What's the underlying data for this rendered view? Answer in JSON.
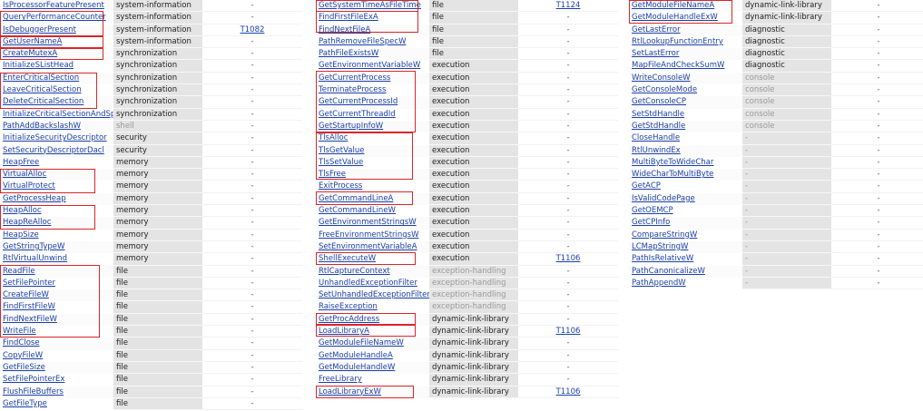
{
  "columns": [
    {
      "rows": [
        {
          "api": "IsProcessorFeaturePresent",
          "category": "system-information",
          "technique": "-"
        },
        {
          "api": "QueryPerformanceCounter",
          "category": "system-information",
          "technique": "-"
        },
        {
          "api": "IsDebuggerPresent",
          "category": "system-information",
          "technique": "T1082"
        },
        {
          "api": "GetUserNameA",
          "category": "system-information",
          "technique": "-"
        },
        {
          "api": "CreateMutexA",
          "category": "synchronization",
          "technique": "-"
        },
        {
          "api": "InitializeSListHead",
          "category": "synchronization",
          "technique": "-"
        },
        {
          "api": "EnterCriticalSection",
          "category": "synchronization",
          "technique": "-"
        },
        {
          "api": "LeaveCriticalSection",
          "category": "synchronization",
          "technique": "-"
        },
        {
          "api": "DeleteCriticalSection",
          "category": "synchronization",
          "technique": "-"
        },
        {
          "api": "InitializeCriticalSectionAndSpi...",
          "category": "synchronization",
          "technique": "-"
        },
        {
          "api": "PathAddBackslashW",
          "category": "shell",
          "technique": "-",
          "dim": true
        },
        {
          "api": "InitializeSecurityDescriptor",
          "category": "security",
          "technique": "-"
        },
        {
          "api": "SetSecurityDescriptorDacl",
          "category": "security",
          "technique": "-"
        },
        {
          "api": "HeapFree",
          "category": "memory",
          "technique": "-"
        },
        {
          "api": "VirtualAlloc",
          "category": "memory",
          "technique": "-"
        },
        {
          "api": "VirtualProtect",
          "category": "memory",
          "technique": "-"
        },
        {
          "api": "GetProcessHeap",
          "category": "memory",
          "technique": "-"
        },
        {
          "api": "HeapAlloc",
          "category": "memory",
          "technique": "-"
        },
        {
          "api": "HeapReAlloc",
          "category": "memory",
          "technique": "-"
        },
        {
          "api": "HeapSize",
          "category": "memory",
          "technique": "-"
        },
        {
          "api": "GetStringTypeW",
          "category": "memory",
          "technique": "-"
        },
        {
          "api": "RtlVirtualUnwind",
          "category": "memory",
          "technique": "-"
        },
        {
          "api": "ReadFile",
          "category": "file",
          "technique": "-"
        },
        {
          "api": "SetFilePointer",
          "category": "file",
          "technique": "-"
        },
        {
          "api": "CreateFileW",
          "category": "file",
          "technique": "-"
        },
        {
          "api": "FindFirstFileW",
          "category": "file",
          "technique": "-"
        },
        {
          "api": "FindNextFileW",
          "category": "file",
          "technique": "-"
        },
        {
          "api": "WriteFile",
          "category": "file",
          "technique": "-"
        },
        {
          "api": "FindClose",
          "category": "file",
          "technique": "-"
        },
        {
          "api": "CopyFileW",
          "category": "file",
          "technique": "-"
        },
        {
          "api": "GetFileSize",
          "category": "file",
          "technique": "-"
        },
        {
          "api": "SetFilePointerEx",
          "category": "file",
          "technique": "-"
        },
        {
          "api": "FlushFileBuffers",
          "category": "file",
          "technique": "-"
        },
        {
          "api": "GetFileType",
          "category": "file",
          "technique": "-"
        }
      ]
    },
    {
      "rows": [
        {
          "api": "GetSystemTimeAsFileTime",
          "category": "file",
          "technique": "T1124"
        },
        {
          "api": "FindFirstFileExA",
          "category": "file",
          "technique": "-"
        },
        {
          "api": "FindNextFileA",
          "category": "file",
          "technique": "-"
        },
        {
          "api": "PathRemoveFileSpecW",
          "category": "file",
          "technique": "-"
        },
        {
          "api": "PathFileExistsW",
          "category": "file",
          "technique": "-"
        },
        {
          "api": "GetEnvironmentVariableW",
          "category": "execution",
          "technique": "-"
        },
        {
          "api": "GetCurrentProcess",
          "category": "execution",
          "technique": "-"
        },
        {
          "api": "TerminateProcess",
          "category": "execution",
          "technique": "-"
        },
        {
          "api": "GetCurrentProcessId",
          "category": "execution",
          "technique": "-"
        },
        {
          "api": "GetCurrentThreadId",
          "category": "execution",
          "technique": "-"
        },
        {
          "api": "GetStartupInfoW",
          "category": "execution",
          "technique": "-"
        },
        {
          "api": "TlsAlloc",
          "category": "execution",
          "technique": "-"
        },
        {
          "api": "TlsGetValue",
          "category": "execution",
          "technique": "-"
        },
        {
          "api": "TlsSetValue",
          "category": "execution",
          "technique": "-"
        },
        {
          "api": "TlsFree",
          "category": "execution",
          "technique": "-"
        },
        {
          "api": "ExitProcess",
          "category": "execution",
          "technique": "-"
        },
        {
          "api": "GetCommandLineA",
          "category": "execution",
          "technique": "-"
        },
        {
          "api": "GetCommandLineW",
          "category": "execution",
          "technique": "-"
        },
        {
          "api": "GetEnvironmentStringsW",
          "category": "execution",
          "technique": "-"
        },
        {
          "api": "FreeEnvironmentStringsW",
          "category": "execution",
          "technique": "-"
        },
        {
          "api": "SetEnvironmentVariableA",
          "category": "execution",
          "technique": "-"
        },
        {
          "api": "ShellExecuteW",
          "category": "execution",
          "technique": "T1106"
        },
        {
          "api": "RtlCaptureContext",
          "category": "exception-handling",
          "technique": "-",
          "dim": true
        },
        {
          "api": "UnhandledExceptionFilter",
          "category": "exception-handling",
          "technique": "-",
          "dim": true
        },
        {
          "api": "SetUnhandledExceptionFilter",
          "category": "exception-handling",
          "technique": "-",
          "dim": true
        },
        {
          "api": "RaiseException",
          "category": "exception-handling",
          "technique": "-",
          "dim": true
        },
        {
          "api": "GetProcAddress",
          "category": "dynamic-link-library",
          "technique": "-"
        },
        {
          "api": "LoadLibraryA",
          "category": "dynamic-link-library",
          "technique": "T1106"
        },
        {
          "api": "GetModuleFileNameW",
          "category": "dynamic-link-library",
          "technique": "-"
        },
        {
          "api": "GetModuleHandleA",
          "category": "dynamic-link-library",
          "technique": "-"
        },
        {
          "api": "GetModuleHandleW",
          "category": "dynamic-link-library",
          "technique": "-"
        },
        {
          "api": "FreeLibrary",
          "category": "dynamic-link-library",
          "technique": "-"
        },
        {
          "api": "LoadLibraryExW",
          "category": "dynamic-link-library",
          "technique": "T1106"
        }
      ]
    },
    {
      "rows": [
        {
          "api": "GetModuleFileNameA",
          "category": "dynamic-link-library",
          "technique": "-"
        },
        {
          "api": "GetModuleHandleExW",
          "category": "dynamic-link-library",
          "technique": "-"
        },
        {
          "api": "GetLastError",
          "category": "diagnostic",
          "technique": "-"
        },
        {
          "api": "RtlLookupFunctionEntry",
          "category": "diagnostic",
          "technique": "-"
        },
        {
          "api": "SetLastError",
          "category": "diagnostic",
          "technique": "-"
        },
        {
          "api": "MapFileAndCheckSumW",
          "category": "diagnostic",
          "technique": "-"
        },
        {
          "api": "WriteConsoleW",
          "category": "console",
          "technique": "-",
          "dim": true
        },
        {
          "api": "GetConsoleMode",
          "category": "console",
          "technique": "-",
          "dim": true
        },
        {
          "api": "GetConsoleCP",
          "category": "console",
          "technique": "-",
          "dim": true
        },
        {
          "api": "SetStdHandle",
          "category": "console",
          "technique": "-",
          "dim": true
        },
        {
          "api": "GetStdHandle",
          "category": "console",
          "technique": "-",
          "dim": true
        },
        {
          "api": "CloseHandle",
          "category": "-",
          "technique": "-",
          "dim": true
        },
        {
          "api": "RtlUnwindEx",
          "category": "-",
          "technique": "-",
          "dim": true
        },
        {
          "api": "MultiByteToWideChar",
          "category": "-",
          "technique": "-",
          "dim": true
        },
        {
          "api": "WideCharToMultiByte",
          "category": "-",
          "technique": "-",
          "dim": true
        },
        {
          "api": "GetACP",
          "category": "-",
          "technique": "-",
          "dim": true
        },
        {
          "api": "IsValidCodePage",
          "category": "-",
          "technique": "-",
          "dim": true
        },
        {
          "api": "GetOEMCP",
          "category": "-",
          "technique": "-",
          "dim": true
        },
        {
          "api": "GetCPInfo",
          "category": "-",
          "technique": "-",
          "dim": true
        },
        {
          "api": "CompareStringW",
          "category": "-",
          "technique": "-",
          "dim": true
        },
        {
          "api": "LCMapStringW",
          "category": "-",
          "technique": "-",
          "dim": true
        },
        {
          "api": "PathIsRelativeW",
          "category": "-",
          "technique": "-",
          "dim": true
        },
        {
          "api": "PathCanonicalizeW",
          "category": "-",
          "technique": "-",
          "dim": true
        },
        {
          "api": "PathAppendW",
          "category": "-",
          "technique": "-",
          "dim": true
        }
      ]
    }
  ]
}
